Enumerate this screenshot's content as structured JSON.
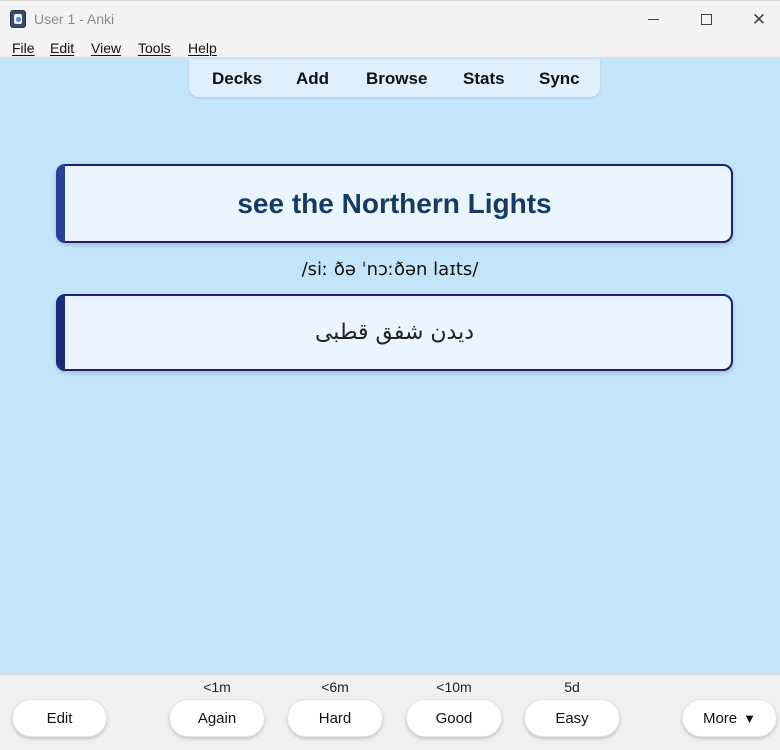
{
  "window": {
    "title": "User 1 - Anki",
    "minimize_icon": "minimize-icon",
    "maximize_icon": "maximize-icon",
    "close_icon": "close-icon",
    "close_glyph": "✕"
  },
  "menu": {
    "items": [
      "File",
      "Edit",
      "View",
      "Tools",
      "Help"
    ]
  },
  "toolbar": {
    "items": [
      "Decks",
      "Add",
      "Browse",
      "Stats",
      "Sync"
    ]
  },
  "card": {
    "front": "see the Northern Lights",
    "pronunciation": "/siː ðə ˈnɔːðən laɪts/",
    "back": "دیدن شفق قطبی"
  },
  "review": {
    "edit_label": "Edit",
    "answers": [
      {
        "label": "Again",
        "interval": "<1m"
      },
      {
        "label": "Hard",
        "interval": "<6m"
      },
      {
        "label": "Good",
        "interval": "<10m"
      },
      {
        "label": "Easy",
        "interval": "5d"
      }
    ],
    "more_label": "More",
    "more_arrow": "▼"
  },
  "colors": {
    "background": "#c4e4fa",
    "card_border": "#1b1f75",
    "front_text": "#173a64"
  }
}
